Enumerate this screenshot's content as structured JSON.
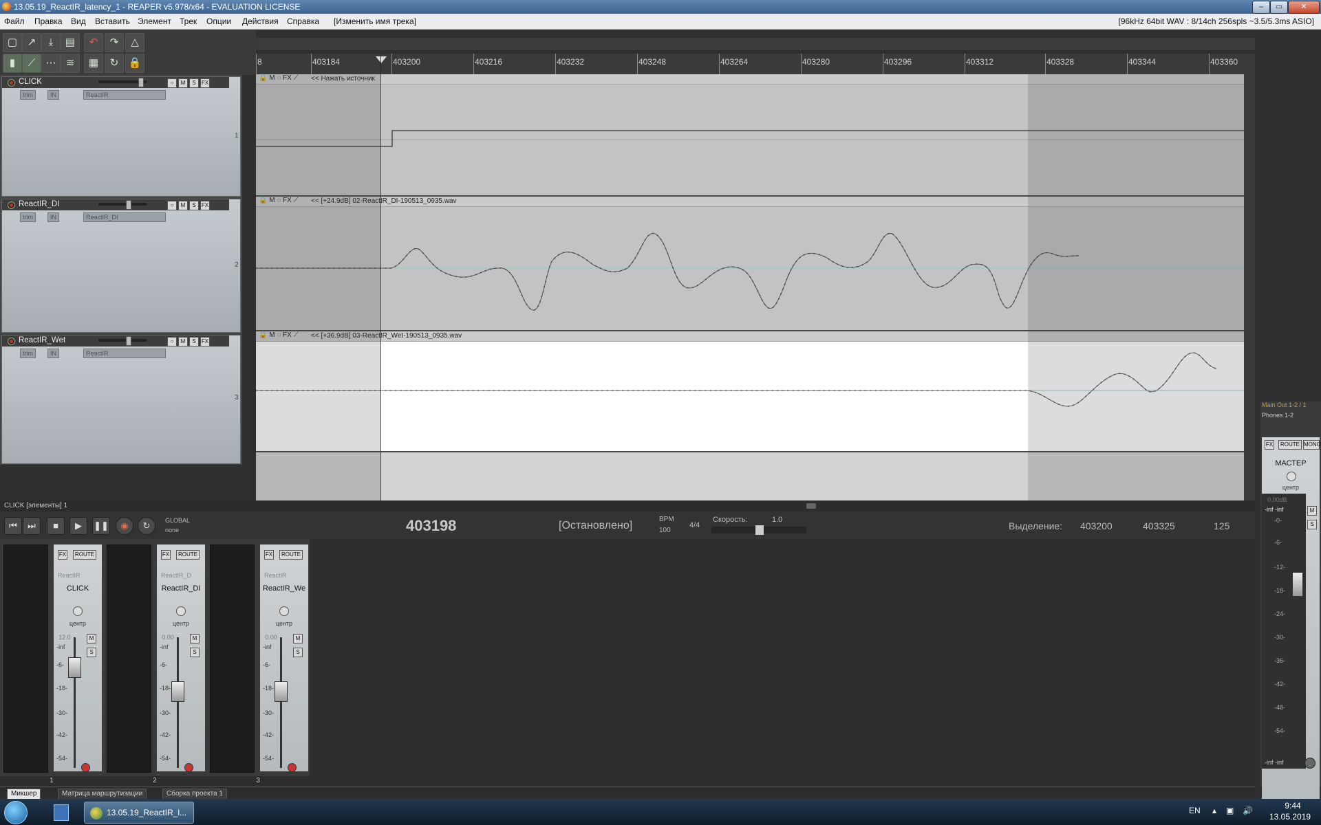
{
  "window": {
    "title": "13.05.19_ReactIR_latency_1 - REAPER v5.978/x64 - EVALUATION LICENSE",
    "status_info": "[96kHz 64bit WAV : 8/14ch 256spls ~3.5/5.3ms ASIO]",
    "controls": [
      "–",
      "▭",
      "✕"
    ]
  },
  "menu": {
    "items": [
      "Файл",
      "Правка",
      "Вид",
      "Вставить",
      "Элемент",
      "Трек",
      "Опции",
      "Действия",
      "Справка",
      "[Изменить имя трека]"
    ]
  },
  "toolbar": {
    "icons": [
      "new-project-icon",
      "open-project-icon",
      "save-project-icon",
      "project-settings-icon",
      "undo-icon",
      "redo-icon",
      "metronome-icon",
      "ripple-edit-icon",
      "auto-crossfade-icon",
      "snap-icon",
      "grid-icon",
      "loop-icon",
      "lock-icon",
      "envelope-icon"
    ]
  },
  "ruler": {
    "labels": [
      "8",
      "403184",
      "403200",
      "403216",
      "403232",
      "403248",
      "403264",
      "403280",
      "403296",
      "403312",
      "403328",
      "403344",
      "403360"
    ]
  },
  "tracks": [
    {
      "name": "CLICK",
      "num": "1",
      "fx_name": "ReactIR",
      "item_label": "<< Нажать источник"
    },
    {
      "name": "ReactIR_DI",
      "num": "2",
      "fx_name": "ReactIR_DI",
      "item_label": "<< [+24.9dB] 02-ReactIR_DI-190513_0935.wav"
    },
    {
      "name": "ReactIR_Wet",
      "num": "3",
      "fx_name": "ReactIR",
      "item_label": "<< [+36.9dB] 03-ReactIR_Wet-190513_0935.wav"
    }
  ],
  "track_controls": {
    "trim": "trim",
    "in": "IN",
    "mute": "M",
    "solo": "S",
    "fx": "FX"
  },
  "status_bar": {
    "text": "CLICK [элементы] 1"
  },
  "transport": {
    "position": "403198",
    "state": "[Остановлено]",
    "bpm_label": "BPM",
    "bpm": "100",
    "time_sig": "4/4",
    "rate_label": "Скорость:",
    "rate": "1.0",
    "global_label": "GLOBAL",
    "global_value": "none",
    "selection_label": "Выделение:",
    "sel_start": "403200",
    "sel_end": "403325",
    "sel_length": "125"
  },
  "mixer": {
    "strips": [
      {
        "name": "CLICK",
        "num": "1",
        "fx": "ReactIR",
        "volume": "12.0",
        "fader_level": 0.82
      },
      {
        "name": "ReactIR_DI",
        "num": "2",
        "fx": "ReactIR_D",
        "volume": "0.00",
        "fader_level": 0.6
      },
      {
        "name": "ReactIR_We",
        "num": "3",
        "fx": "ReactIR",
        "volume": "0.00",
        "fader_level": 0.6
      }
    ],
    "pan_label": "центр",
    "route": "ROUTE",
    "scale": [
      "-inf",
      "-6-",
      "-18-",
      "-30-",
      "-42-",
      "-54-"
    ],
    "master": {
      "title": "МАСТЕР",
      "pan": "центр",
      "out1": "Main Out 1-2 / 1",
      "out2": "Phones 1-2",
      "volume": "0.00dB",
      "peak": "-inf -inf",
      "mono": "MONO",
      "route": "ROUTE",
      "scale": [
        "-0-",
        "-6-",
        "-12-",
        "-18-",
        "-24-",
        "-30-",
        "-36-",
        "-42-",
        "-48-",
        "-54-"
      ],
      "bottom": "-inf -inf"
    }
  },
  "dock_tabs": [
    "Микшер",
    "Матрица маршрутизации",
    "Сборка проекта 1"
  ],
  "taskbar": {
    "task": "13.05.19_ReactIR_l...",
    "lang": "EN",
    "time": "9:44",
    "date": "13.05.2019"
  },
  "colors": {
    "accent": "#3e6592",
    "waveform": "#333333",
    "tcp_bg": "#b7bdc1"
  }
}
